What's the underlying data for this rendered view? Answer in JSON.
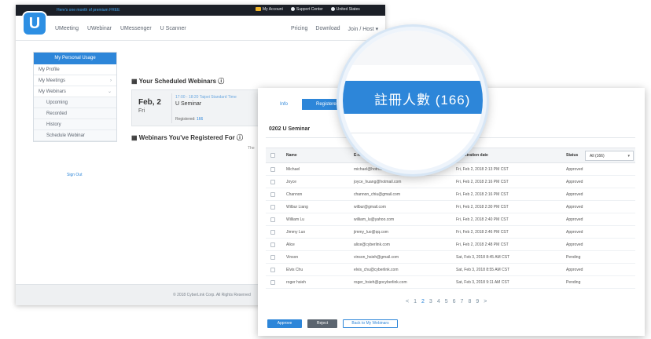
{
  "back_window": {
    "promo": "Here's one month of premium FREE",
    "top_links": [
      "My Account",
      "Support Center",
      "United States"
    ],
    "logo_letter": "U",
    "nav": [
      "UMeeting",
      "UWebinar",
      "UMessenger",
      "U Scanner"
    ],
    "nav_right": [
      "Pricing",
      "Download",
      "Join / Host"
    ],
    "sidebar": {
      "header": "My Personal Usage",
      "items": [
        {
          "label": "My Profile"
        },
        {
          "label": "My Meetings"
        },
        {
          "label": "My Webinars"
        },
        {
          "label": "Upcoming"
        },
        {
          "label": "Recorded"
        },
        {
          "label": "History"
        },
        {
          "label": "Schedule Webinar"
        }
      ],
      "signout": "Sign Out"
    },
    "scheduled": {
      "title": "Your Scheduled Webinars",
      "date": "Feb, 2",
      "day": "Fri",
      "time": "17:00 - 18:20 Taipei Standard Time",
      "name": "U Seminar",
      "registered_label": "Registered:",
      "registered_count": "166"
    },
    "registered_for_title": "Webinars You've Registered For",
    "registered_for_text": "The",
    "footer": "© 2018 CyberLink Corp. All Rights Reserved"
  },
  "front_panel": {
    "tabs": [
      "Info",
      "Registered (166)"
    ],
    "webinar_title": "0202 U Seminar",
    "columns": {
      "name": "Name",
      "email": "E-mail address",
      "date": "Registration date",
      "status": "Status"
    },
    "status_filter": "All (166)",
    "rows": [
      {
        "name": "Michael",
        "email": "michael@hotmail.com",
        "date": "Fri, Feb 2, 2018 2:13 PM CST",
        "status": "Approved"
      },
      {
        "name": "Joyce",
        "email": "joyce_huang@hotmail.com",
        "date": "Fri, Feb 2, 2018 2:16 PM CST",
        "status": "Approved"
      },
      {
        "name": "Channon",
        "email": "channon_chiu@gmail.com",
        "date": "Fri, Feb 2, 2018 2:16 PM CST",
        "status": "Approved"
      },
      {
        "name": "Wilbur Liang",
        "email": "wilbur@gmail.com",
        "date": "Fri, Feb 2, 2018 2:30 PM CST",
        "status": "Approved"
      },
      {
        "name": "William Lu",
        "email": "william_lu@yahoo.com",
        "date": "Fri, Feb 2, 2018 2:40 PM CST",
        "status": "Approved"
      },
      {
        "name": "Jimmy Luo",
        "email": "jimmy_luo@qq.com",
        "date": "Fri, Feb 2, 2018 2:46 PM CST",
        "status": "Approved"
      },
      {
        "name": "Alice",
        "email": "alice@cyberlink.com",
        "date": "Fri, Feb 2, 2018 2:48 PM CST",
        "status": "Approved"
      },
      {
        "name": "Vinson",
        "email": "vinson_hsieh@gmail.com",
        "date": "Sat, Feb 3, 2018 8:45 AM CST",
        "status": "Pending"
      },
      {
        "name": "Elvis Chu",
        "email": "elvis_chu@cyberlink.com",
        "date": "Sat, Feb 3, 2018 8:55 AM CST",
        "status": "Approved"
      },
      {
        "name": "roger hsieh",
        "email": "roger_hsieh@gocyberlink.com",
        "date": "Sat, Feb 3, 2018 9:11 AM CST",
        "status": "Pending"
      }
    ],
    "pager": {
      "prev": "<",
      "pages": [
        "1",
        "2",
        "3",
        "4",
        "5",
        "6",
        "7",
        "8",
        "9"
      ],
      "next": ">"
    },
    "buttons": {
      "approve": "Approve",
      "reject": "Reject",
      "back": "Back to My Webinars"
    }
  },
  "magnifier": {
    "text": "註冊人數 (166)"
  },
  "colors": {
    "accent": "#2d86d9",
    "topbar": "#1b1f27",
    "reject": "#5b6570"
  }
}
